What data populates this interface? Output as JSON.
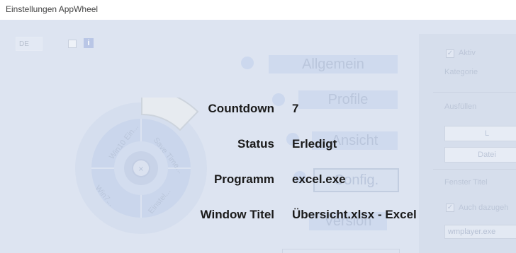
{
  "window": {
    "title": "Einstellungen AppWheel"
  },
  "background": {
    "language": "DE",
    "info_icon": "i",
    "menu": [
      "Allgemein",
      "Profile",
      "Ansicht",
      "Config.",
      "Version"
    ],
    "wheel_segments": [
      "Win10 Ein...",
      "Save Time...",
      "Win7...",
      "Einstel..."
    ],
    "side_panel": {
      "aktiv_label": "Aktiv",
      "kategorie_label": "Kategorie",
      "ausfuellen_label": "Ausfüllen",
      "btn1": "L",
      "btn2": "Datei",
      "fenster_titel_label": "Fenster Titel",
      "auch_label": "Auch dazugeh",
      "process_value": "wmplayer.exe"
    }
  },
  "info": {
    "rows": [
      {
        "label": "Countdown",
        "value": "7"
      },
      {
        "label": "Status",
        "value": "Erledigt"
      },
      {
        "label": "Programm",
        "value": "excel.exe"
      },
      {
        "label": "Window Titel",
        "value": "Übersicht.xlsx - Excel"
      }
    ]
  },
  "colors": {
    "overlay_bg": "#dde4f1",
    "text": "#1a1a1a"
  }
}
